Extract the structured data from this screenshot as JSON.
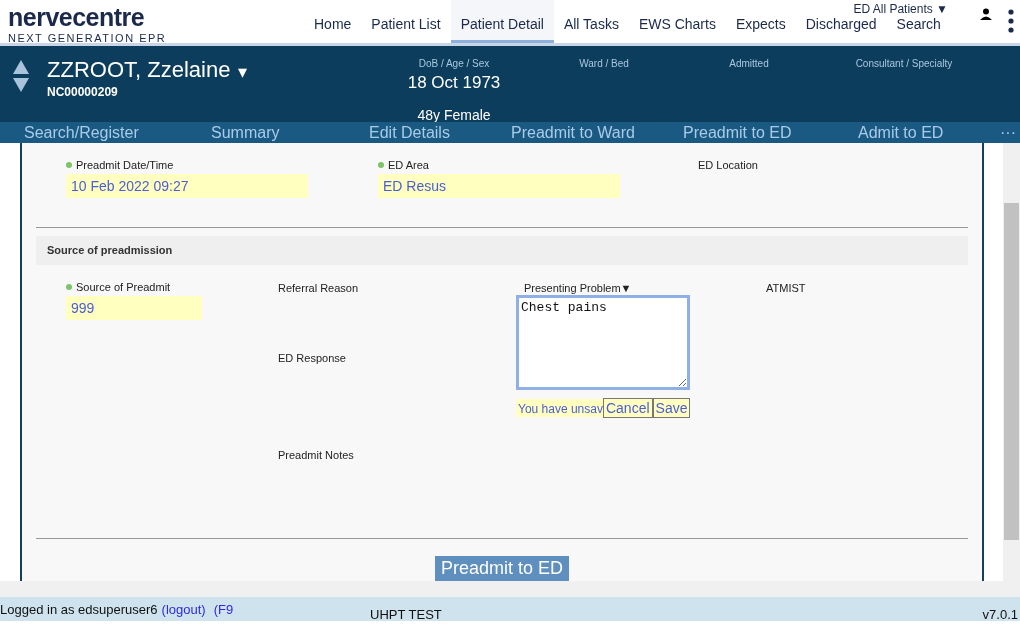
{
  "app": {
    "logo_title": "nervecentre",
    "logo_subtitle": "NEXT GENERATION EPR"
  },
  "nav": [
    {
      "label": "Home",
      "selected": false
    },
    {
      "label": "Patient List",
      "selected": false
    },
    {
      "label": "Patient Detail",
      "selected": true
    },
    {
      "label": "All Tasks",
      "selected": false
    },
    {
      "label": "EWS Charts",
      "selected": false
    },
    {
      "label": "Expects",
      "selected": false
    },
    {
      "label": "Discharged",
      "selected": false
    },
    {
      "label": "Search",
      "selected": false
    }
  ],
  "ward_filter": "ED All Patients ▼",
  "patient": {
    "name": "ZZROOT, Zzelaine",
    "name_caret": "▾",
    "id": "NC00000209",
    "fields": [
      {
        "label": "DoB / Age / Sex",
        "value": "18 Oct 1973",
        "detail": "48y Female"
      },
      {
        "label": "Ward / Bed"
      },
      {
        "label": "Admitted"
      },
      {
        "label": "Consultant / Specialty"
      }
    ]
  },
  "actions": [
    "Search/Register",
    "Summary",
    "Edit Details",
    "Preadmit to Ward",
    "Preadmit to ED",
    "Admit to ED"
  ],
  "actions_more": "···",
  "form": {
    "top_fields": [
      {
        "label": "Preadmit Date/Time",
        "required": true,
        "value": "10 Feb 2022 09:27"
      },
      {
        "label": "ED Area",
        "required": true,
        "value": "ED Resus"
      },
      {
        "label": "ED Location",
        "required": false
      }
    ],
    "section_title": "Source of preadmission",
    "source": {
      "label": "Source of Preadmit",
      "required": true,
      "value": "999"
    },
    "referral_reason": "Referral Reason",
    "ed_response": "ED Response",
    "preadmit_notes": "Preadmit Notes",
    "presenting_problem": {
      "label": "Presenting Problem▼",
      "value": "Chest pains",
      "unsaved": "You have unsav",
      "cancel": "Cancel",
      "save": "Save"
    },
    "atmist": "ATMIST",
    "submit": "Preadmit to ED"
  },
  "status_bar": {
    "login": "Logged in as edsuperuser6",
    "logout": "(logout)",
    "shortcut": "(F9",
    "environment": "UHPT TEST",
    "version": "v7.0.1"
  }
}
